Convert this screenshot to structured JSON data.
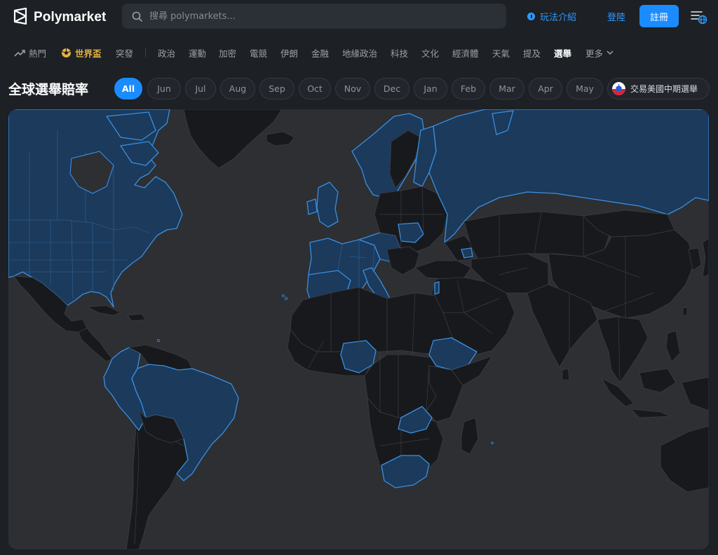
{
  "header": {
    "brand": "Polymarket",
    "search_placeholder": "搜尋 polymarkets...",
    "how_it_works": "玩法介紹",
    "login": "登陸",
    "signup": "註冊"
  },
  "nav": {
    "items": [
      {
        "label": "熱門",
        "icon": "trending-up-icon"
      },
      {
        "label": "世界盃",
        "icon": "soccer-ball-icon"
      },
      {
        "label": "突發"
      },
      {
        "label": "政治"
      },
      {
        "label": "運動"
      },
      {
        "label": "加密"
      },
      {
        "label": "電競"
      },
      {
        "label": "伊朗"
      },
      {
        "label": "金融"
      },
      {
        "label": "地緣政治"
      },
      {
        "label": "科技"
      },
      {
        "label": "文化"
      },
      {
        "label": "經濟體"
      },
      {
        "label": "天氣"
      },
      {
        "label": "提及"
      },
      {
        "label": "選舉"
      },
      {
        "label": "更多"
      }
    ],
    "active": "選舉"
  },
  "page": {
    "title": "全球選舉賠率"
  },
  "filters": {
    "months": [
      "All",
      "Jun",
      "Jul",
      "Aug",
      "Sep",
      "Oct",
      "Nov",
      "Dec",
      "Jan",
      "Feb",
      "Mar",
      "Apr",
      "May"
    ],
    "selected": "All",
    "promo_label": "交易美國中期選舉"
  },
  "map": {
    "highlighted_regions": [
      "North America",
      "Europe",
      "Russia",
      "Brazil",
      "Colombia",
      "Ecuador",
      "Peru",
      "Nigeria",
      "Ethiopia",
      "Zambia",
      "South Africa",
      "Israel",
      "Armenia"
    ],
    "colors": {
      "ocean": "#2d2f33",
      "land": "#18191c",
      "highlight_fill": "#1b3a5c",
      "highlight_border": "#3b8fe0",
      "border": "#3a3d42"
    }
  },
  "colors": {
    "accent": "#1a8cff",
    "background": "#1d2025",
    "world_cup_gold": "#e3b341"
  }
}
